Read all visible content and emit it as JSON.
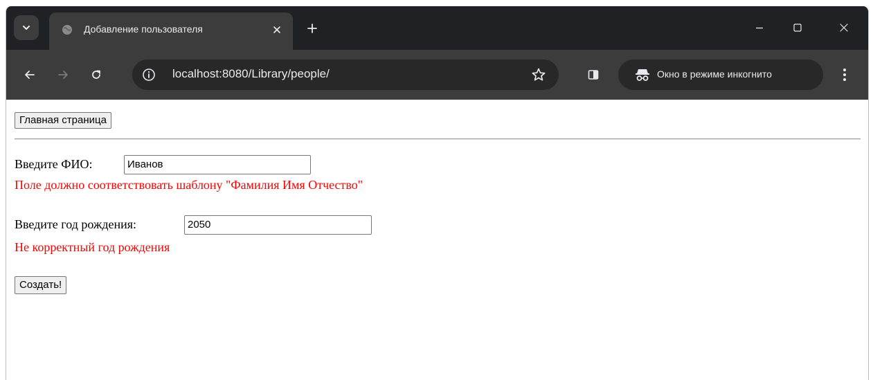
{
  "browser": {
    "tab_title": "Добавление пользователя",
    "url": "localhost:8080/Library/people/",
    "incognito_label": "Окно в режиме инкогнито",
    "colors": {
      "frame": "#202124",
      "toolbar": "#3c3c3c",
      "omnibox": "#282828",
      "text": "#e8eaed"
    }
  },
  "page": {
    "home_button": "Главная страница",
    "name_label": "Введите ФИО:",
    "name_value": "Иванов",
    "name_error": "Поле должно соответствовать шаблону \"Фамилия Имя Отчество\"",
    "year_label": "Введите год рождения:",
    "year_value": "2050",
    "year_error": "Не корректный год рождения",
    "submit_button": "Создать!",
    "error_color": "#ff0000"
  }
}
